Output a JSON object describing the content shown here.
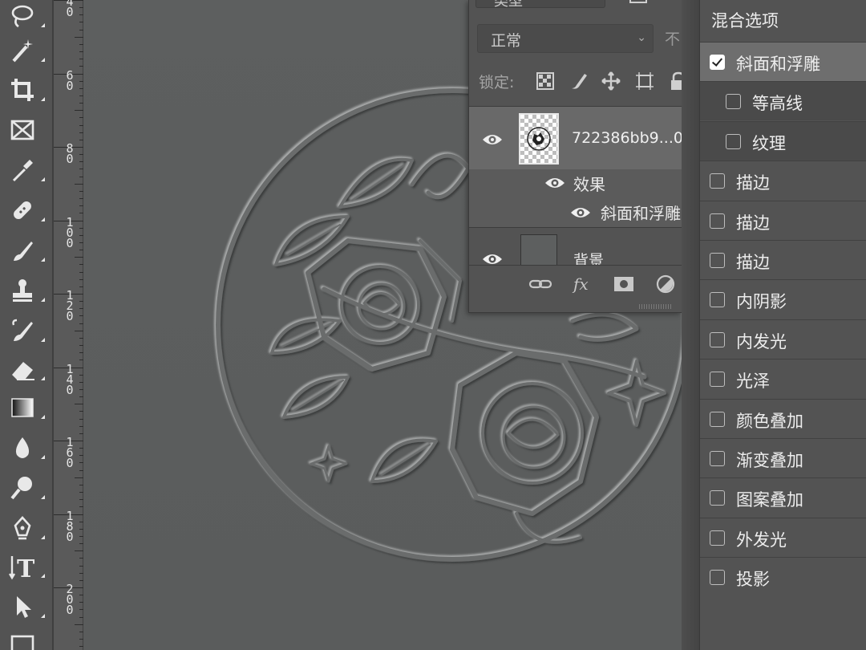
{
  "toolbar": {
    "tools": [
      {
        "name": "lasso-tool-icon",
        "flyout": true
      },
      {
        "name": "magic-wand-tool-icon",
        "flyout": true
      },
      {
        "name": "crop-tool-icon",
        "flyout": true
      },
      {
        "name": "frame-tool-icon",
        "flyout": false
      },
      {
        "name": "eyedropper-tool-icon",
        "flyout": true
      },
      {
        "name": "healing-brush-tool-icon",
        "flyout": true
      },
      {
        "name": "brush-tool-icon",
        "flyout": true
      },
      {
        "name": "clone-stamp-tool-icon",
        "flyout": true
      },
      {
        "name": "history-brush-tool-icon",
        "flyout": true
      },
      {
        "name": "eraser-tool-icon",
        "flyout": true
      },
      {
        "name": "gradient-tool-icon",
        "flyout": true
      },
      {
        "name": "blur-tool-icon",
        "flyout": true
      },
      {
        "name": "dodge-tool-icon",
        "flyout": true
      },
      {
        "name": "pen-tool-icon",
        "flyout": true
      },
      {
        "name": "type-tool-icon",
        "flyout": true
      },
      {
        "name": "path-selection-tool-icon",
        "flyout": true
      },
      {
        "name": "rectangle-tool-icon",
        "flyout": false
      }
    ]
  },
  "ruler": {
    "labels": [
      "40",
      "60",
      "80",
      "100",
      "120",
      "140",
      "160",
      "180",
      "200"
    ]
  },
  "layers_panel": {
    "search_partial": "类型",
    "blend_mode": "正常",
    "opacity_partial": "不",
    "lock_label": "锁定:",
    "layers": [
      {
        "name": "722386bb9...0",
        "visible": true,
        "selected": true
      },
      {
        "name": "背景",
        "visible": true,
        "selected": false
      }
    ],
    "effects_label": "效果",
    "effect_item": "斜面和浮雕"
  },
  "layer_style": {
    "title": "混合选项",
    "options": [
      {
        "label": "斜面和浮雕",
        "checked": true,
        "selected": true,
        "sub": false
      },
      {
        "label": "等高线",
        "checked": false,
        "selected": false,
        "sub": true
      },
      {
        "label": "纹理",
        "checked": false,
        "selected": false,
        "sub": true
      },
      {
        "label": "描边",
        "checked": false,
        "selected": false,
        "sub": false
      },
      {
        "label": "描边",
        "checked": false,
        "selected": false,
        "sub": false
      },
      {
        "label": "描边",
        "checked": false,
        "selected": false,
        "sub": false
      },
      {
        "label": "内阴影",
        "checked": false,
        "selected": false,
        "sub": false
      },
      {
        "label": "内发光",
        "checked": false,
        "selected": false,
        "sub": false
      },
      {
        "label": "光泽",
        "checked": false,
        "selected": false,
        "sub": false
      },
      {
        "label": "颜色叠加",
        "checked": false,
        "selected": false,
        "sub": false
      },
      {
        "label": "渐变叠加",
        "checked": false,
        "selected": false,
        "sub": false
      },
      {
        "label": "图案叠加",
        "checked": false,
        "selected": false,
        "sub": false
      },
      {
        "label": "外发光",
        "checked": false,
        "selected": false,
        "sub": false
      },
      {
        "label": "投影",
        "checked": false,
        "selected": false,
        "sub": false
      }
    ]
  },
  "colors": {
    "panel_bg": "#535353",
    "canvas_bg": "#5d5f5f",
    "selected_row": "#6e6e6e",
    "text": "#ededed"
  }
}
